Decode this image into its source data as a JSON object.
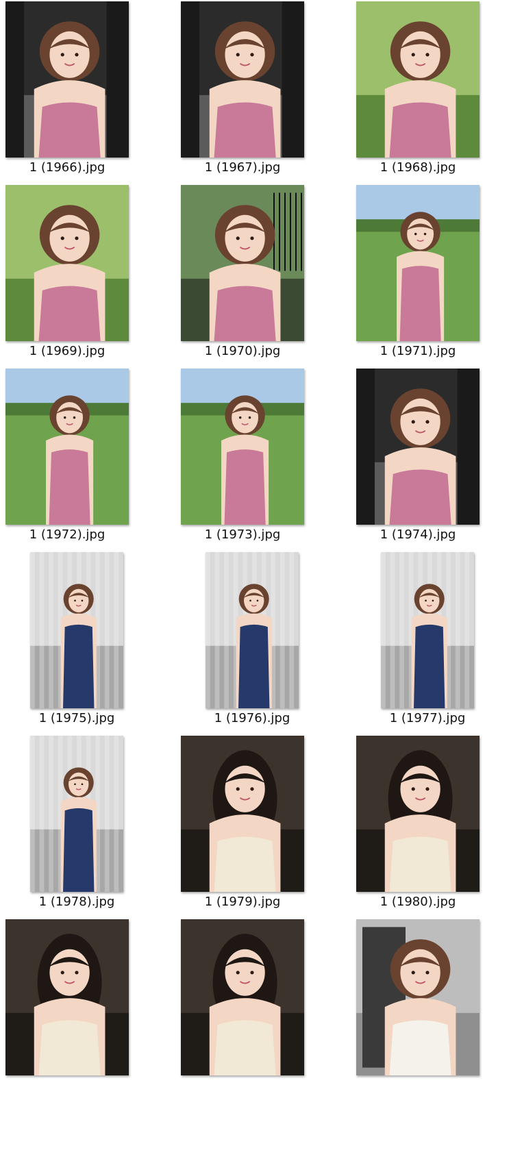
{
  "files": [
    {
      "name": "1 (1966).jpg",
      "scene": "car",
      "outfit": "pink",
      "hair": "brown-bob",
      "orientation": "portrait"
    },
    {
      "name": "1 (1967).jpg",
      "scene": "car",
      "outfit": "pink",
      "hair": "brown-bob",
      "orientation": "portrait"
    },
    {
      "name": "1 (1968).jpg",
      "scene": "park",
      "outfit": "pink",
      "hair": "brown-bob",
      "orientation": "portrait"
    },
    {
      "name": "1 (1969).jpg",
      "scene": "park",
      "outfit": "pink",
      "hair": "brown-bob",
      "orientation": "portrait"
    },
    {
      "name": "1 (1970).jpg",
      "scene": "railing",
      "outfit": "pink",
      "hair": "brown-bob",
      "orientation": "portrait"
    },
    {
      "name": "1 (1971).jpg",
      "scene": "park-wide",
      "outfit": "pink",
      "hair": "brown-bob",
      "orientation": "portrait"
    },
    {
      "name": "1 (1972).jpg",
      "scene": "park-wide",
      "outfit": "pink",
      "hair": "brown-bob",
      "orientation": "portrait"
    },
    {
      "name": "1 (1973).jpg",
      "scene": "park-wide",
      "outfit": "pink",
      "hair": "brown-bob",
      "orientation": "portrait"
    },
    {
      "name": "1 (1974).jpg",
      "scene": "car",
      "outfit": "pink",
      "hair": "brown-bob",
      "orientation": "portrait"
    },
    {
      "name": "1 (1975).jpg",
      "scene": "curtain",
      "outfit": "navy",
      "hair": "brown-bob",
      "orientation": "tall"
    },
    {
      "name": "1 (1976).jpg",
      "scene": "curtain",
      "outfit": "navy",
      "hair": "brown-bob",
      "orientation": "tall"
    },
    {
      "name": "1 (1977).jpg",
      "scene": "curtain",
      "outfit": "navy",
      "hair": "brown-bob",
      "orientation": "tall"
    },
    {
      "name": "1 (1978).jpg",
      "scene": "curtain",
      "outfit": "navy",
      "hair": "brown-bob",
      "orientation": "tall"
    },
    {
      "name": "1 (1979).jpg",
      "scene": "dark-room",
      "outfit": "cream",
      "hair": "black-long",
      "orientation": "portrait"
    },
    {
      "name": "1 (1980).jpg",
      "scene": "dark-room",
      "outfit": "cream",
      "hair": "black-long",
      "orientation": "portrait"
    },
    {
      "name": "",
      "scene": "dark-room",
      "outfit": "cream",
      "hair": "black-long",
      "orientation": "portrait"
    },
    {
      "name": "",
      "scene": "dark-room",
      "outfit": "cream",
      "hair": "black-long",
      "orientation": "portrait"
    },
    {
      "name": "",
      "scene": "bathroom",
      "outfit": "white",
      "hair": "brown-bob",
      "orientation": "portrait"
    }
  ],
  "colors": {
    "pink": "#c87a98",
    "navy": "#253a6b",
    "cream": "#f1e9d6",
    "white": "#f4f2ea",
    "brown-bob": "#6a4330",
    "black-long": "#1e1713",
    "skin": "#f4d6c4"
  }
}
